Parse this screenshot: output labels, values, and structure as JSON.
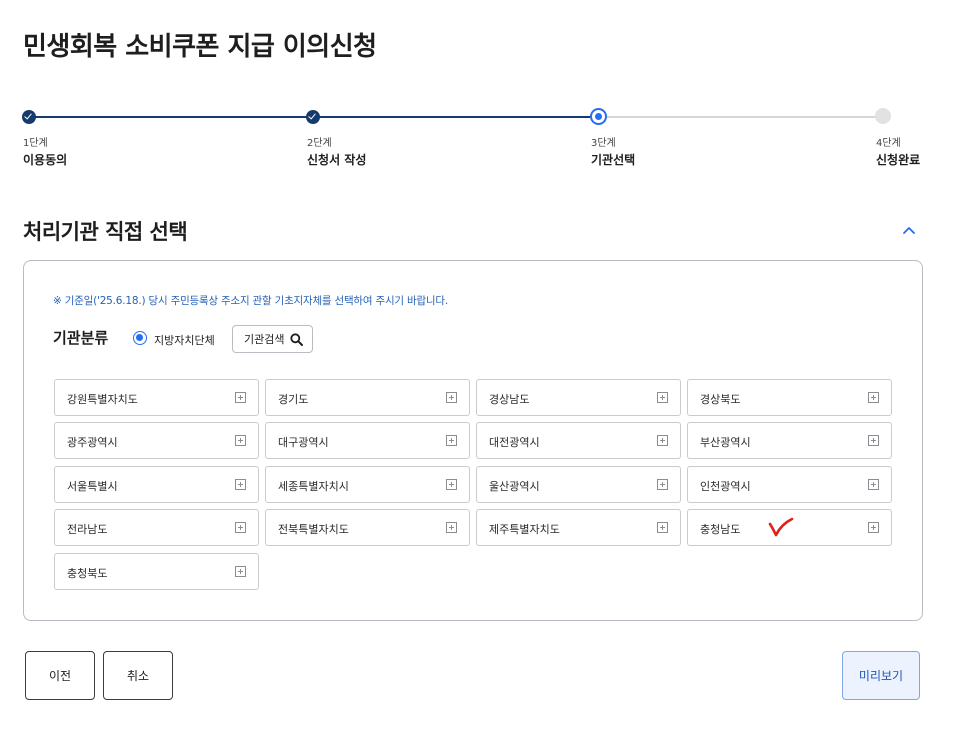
{
  "page": {
    "title": "민생회복 소비쿠폰 지급 이의신청"
  },
  "steps": [
    {
      "num": "1단계",
      "name": "이용동의",
      "state": "done"
    },
    {
      "num": "2단계",
      "name": "신청서 작성",
      "state": "done"
    },
    {
      "num": "3단계",
      "name": "기관선택",
      "state": "current"
    },
    {
      "num": "4단계",
      "name": "신청완료",
      "state": "todo"
    }
  ],
  "section": {
    "title": "처리기관 직접 선택",
    "collapse_icon": "chevron-up-icon",
    "notice": "※ 기준일('25.6.18.) 당시 주민등록상 주소지 관할 기초지자체를 선택하여 주시기 바랍니다.",
    "category_label": "기관분류",
    "radio_label": "지방자치단체",
    "radio_selected": true,
    "search_label": "기관검색",
    "regions": [
      "강원특별자치도",
      "경기도",
      "경상남도",
      "경상북도",
      "광주광역시",
      "대구광역시",
      "대전광역시",
      "부산광역시",
      "서울특별시",
      "세종특별자치시",
      "울산광역시",
      "인천광역시",
      "전라남도",
      "전북특별자치도",
      "제주특별자치도",
      "충청남도",
      "충청북도"
    ],
    "checked_region": "충청남도"
  },
  "buttons": {
    "prev": "이전",
    "cancel": "취소",
    "preview": "미리보기"
  },
  "colors": {
    "primary": "#163a6b",
    "accent": "#256ef4",
    "notice": "#2563b8",
    "check_mark": "#e0201a"
  }
}
